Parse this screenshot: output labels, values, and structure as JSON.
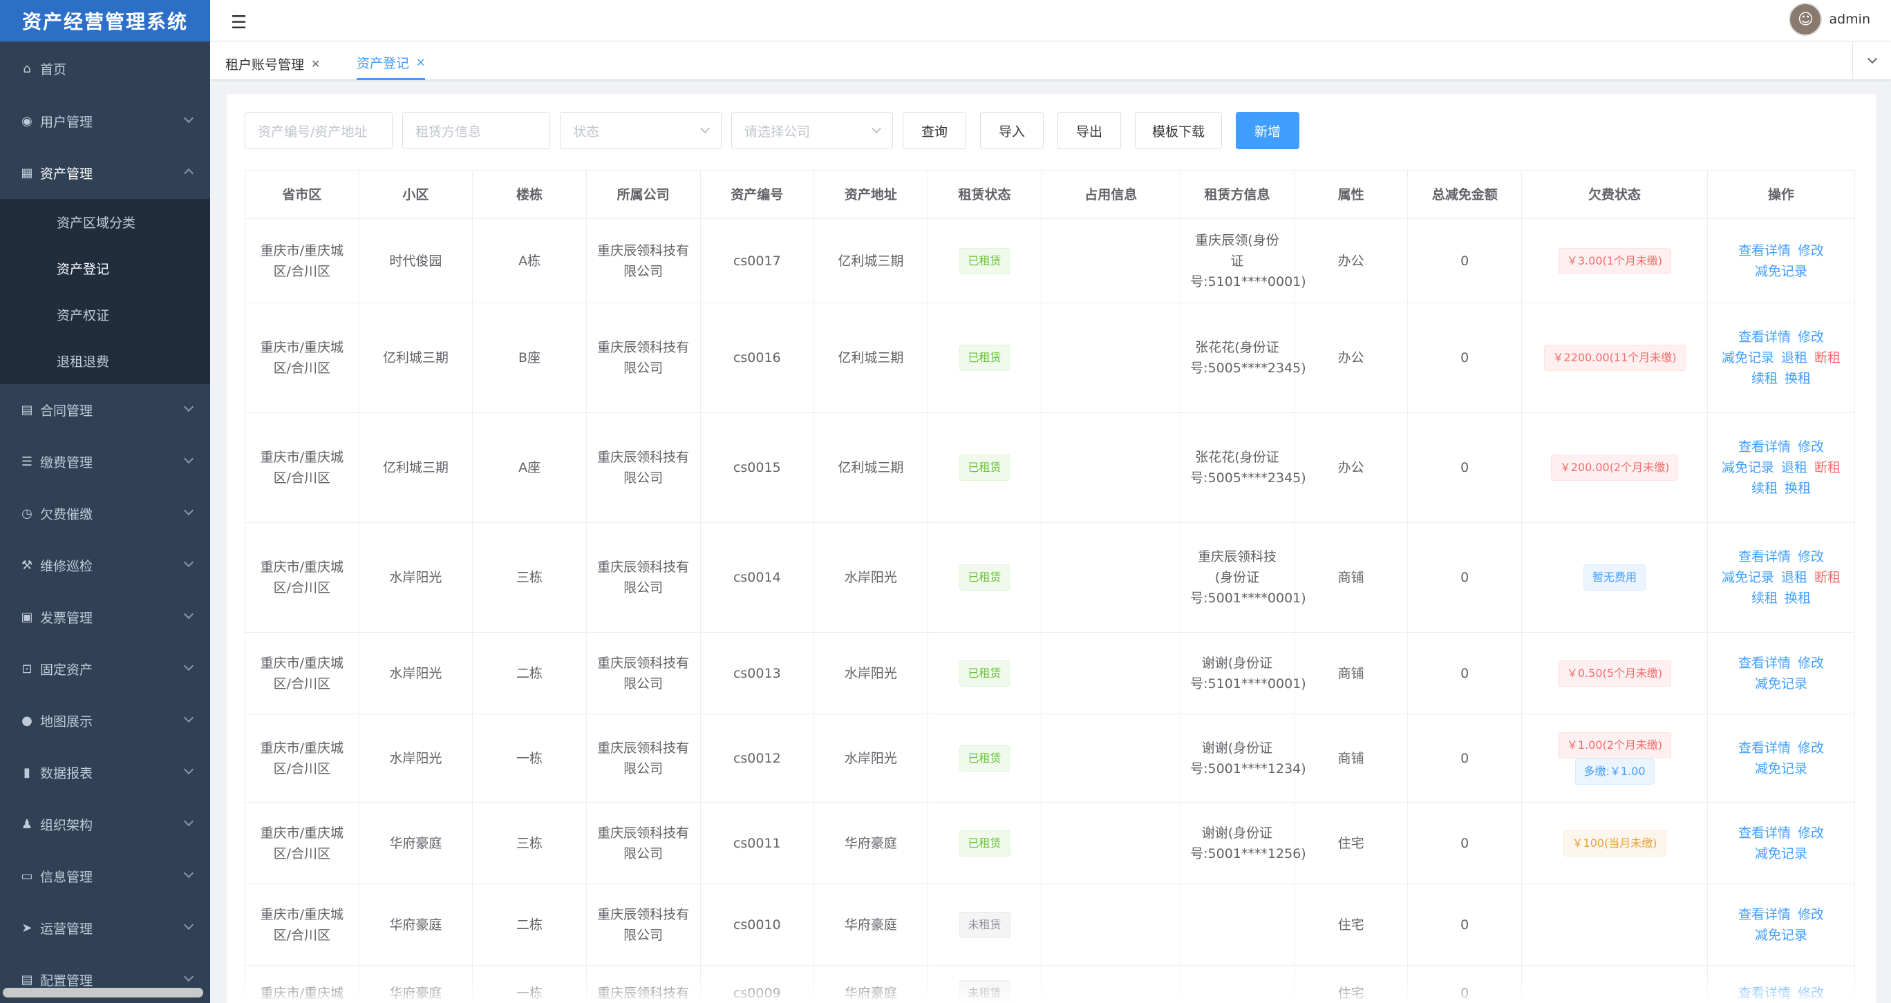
{
  "app": {
    "title": "资产经营管理系统"
  },
  "header": {
    "user_name": "admin"
  },
  "sidebar": {
    "items": [
      {
        "label": "首页",
        "icon": "home-icon",
        "glyph": "⌂"
      },
      {
        "label": "用户管理",
        "icon": "user-circle-icon",
        "glyph": "◉"
      },
      {
        "label": "资产管理",
        "icon": "grid-icon",
        "glyph": "▦",
        "expanded": true,
        "children": [
          {
            "label": "资产区域分类"
          },
          {
            "label": "资产登记",
            "active": true
          },
          {
            "label": "资产权证"
          },
          {
            "label": "退租退费"
          }
        ]
      },
      {
        "label": "合同管理",
        "icon": "document-icon",
        "glyph": "▤"
      },
      {
        "label": "缴费管理",
        "icon": "list-icon",
        "glyph": "☰"
      },
      {
        "label": "欠费催缴",
        "icon": "clock-icon",
        "glyph": "◷"
      },
      {
        "label": "维修巡检",
        "icon": "tool-icon",
        "glyph": "⚒"
      },
      {
        "label": "发票管理",
        "icon": "invoice-icon",
        "glyph": "▣"
      },
      {
        "label": "固定资产",
        "icon": "lock-icon",
        "glyph": "⊡"
      },
      {
        "label": "地图展示",
        "icon": "location-icon",
        "glyph": "●"
      },
      {
        "label": "数据报表",
        "icon": "bar-chart-icon",
        "glyph": "▮"
      },
      {
        "label": "组织架构",
        "icon": "person-icon",
        "glyph": "♟"
      },
      {
        "label": "信息管理",
        "icon": "message-icon",
        "glyph": "▭"
      },
      {
        "label": "运营管理",
        "icon": "send-icon",
        "glyph": "➤"
      },
      {
        "label": "配置管理",
        "icon": "settings-doc-icon",
        "glyph": "▤"
      }
    ]
  },
  "tabs": [
    {
      "label": "租户账号管理",
      "active": false
    },
    {
      "label": "资产登记",
      "active": true
    }
  ],
  "filters": {
    "asset_code_placeholder": "资产编号/资产地址",
    "tenant_placeholder": "租赁方信息",
    "status_placeholder": "状态",
    "company_placeholder": "请选择公司"
  },
  "buttons": {
    "query": "查询",
    "import": "导入",
    "export": "导出",
    "template": "模板下载",
    "add": "新增"
  },
  "table": {
    "columns": [
      "省市区",
      "小区",
      "楼栋",
      "所属公司",
      "资产编号",
      "资产地址",
      "租赁状态",
      "占用信息",
      "租赁方信息",
      "属性",
      "总减免金额",
      "欠费状态",
      "操作"
    ],
    "rows": [
      {
        "region": "重庆市/重庆城区/合川区",
        "community": "时代俊园",
        "building": "A栋",
        "company": "重庆辰领科技有限公司",
        "code": "cs0017",
        "address": "亿利城三期",
        "status": "已租赁",
        "status_type": "success",
        "occupancy": "",
        "tenant": "重庆辰领(身份证号:5101****0001)",
        "property": "办公",
        "discount": "0",
        "arrears": [
          {
            "text": "￥3.00(1个月未缴)",
            "type": "danger"
          }
        ],
        "ops": [
          [
            "查看详情",
            "修改"
          ],
          [
            "减免记录"
          ]
        ]
      },
      {
        "region": "重庆市/重庆城区/合川区",
        "community": "亿利城三期",
        "building": "B座",
        "company": "重庆辰领科技有限公司",
        "code": "cs0016",
        "address": "亿利城三期",
        "status": "已租赁",
        "status_type": "success",
        "occupancy": "",
        "tenant": "张花花(身份证号:5005****2345)",
        "property": "办公",
        "discount": "0",
        "arrears": [
          {
            "text": "￥2200.00(11个月未缴)",
            "type": "danger"
          }
        ],
        "ops": [
          [
            "查看详情",
            "修改"
          ],
          [
            "减免记录",
            "退租",
            "断租"
          ],
          [
            "续租",
            "换租"
          ]
        ]
      },
      {
        "region": "重庆市/重庆城区/合川区",
        "community": "亿利城三期",
        "building": "A座",
        "company": "重庆辰领科技有限公司",
        "code": "cs0015",
        "address": "亿利城三期",
        "status": "已租赁",
        "status_type": "success",
        "occupancy": "",
        "tenant": "张花花(身份证号:5005****2345)",
        "property": "办公",
        "discount": "0",
        "arrears": [
          {
            "text": "￥200.00(2个月未缴)",
            "type": "danger"
          }
        ],
        "ops": [
          [
            "查看详情",
            "修改"
          ],
          [
            "减免记录",
            "退租",
            "断租"
          ],
          [
            "续租",
            "换租"
          ]
        ]
      },
      {
        "region": "重庆市/重庆城区/合川区",
        "community": "水岸阳光",
        "building": "三栋",
        "company": "重庆辰领科技有限公司",
        "code": "cs0014",
        "address": "水岸阳光",
        "status": "已租赁",
        "status_type": "success",
        "occupancy": "",
        "tenant": "重庆辰领科技(身份证号:5001****0001)",
        "property": "商铺",
        "discount": "0",
        "arrears": [
          {
            "text": "暂无费用",
            "type": "primary"
          }
        ],
        "ops": [
          [
            "查看详情",
            "修改"
          ],
          [
            "减免记录",
            "退租",
            "断租"
          ],
          [
            "续租",
            "换租"
          ]
        ]
      },
      {
        "region": "重庆市/重庆城区/合川区",
        "community": "水岸阳光",
        "building": "二栋",
        "company": "重庆辰领科技有限公司",
        "code": "cs0013",
        "address": "水岸阳光",
        "status": "已租赁",
        "status_type": "success",
        "occupancy": "",
        "tenant": "谢谢(身份证号:5101****0001)",
        "property": "商铺",
        "discount": "0",
        "arrears": [
          {
            "text": "￥0.50(5个月未缴)",
            "type": "danger"
          }
        ],
        "ops": [
          [
            "查看详情",
            "修改"
          ],
          [
            "减免记录"
          ]
        ]
      },
      {
        "region": "重庆市/重庆城区/合川区",
        "community": "水岸阳光",
        "building": "一栋",
        "company": "重庆辰领科技有限公司",
        "code": "cs0012",
        "address": "水岸阳光",
        "status": "已租赁",
        "status_type": "success",
        "occupancy": "",
        "tenant": "谢谢(身份证号:5001****1234)",
        "property": "商铺",
        "discount": "0",
        "arrears": [
          {
            "text": "￥1.00(2个月未缴)",
            "type": "danger"
          },
          {
            "text": "多缴:￥1.00",
            "type": "primary"
          }
        ],
        "ops": [
          [
            "查看详情",
            "修改"
          ],
          [
            "减免记录"
          ]
        ]
      },
      {
        "region": "重庆市/重庆城区/合川区",
        "community": "华府豪庭",
        "building": "三栋",
        "company": "重庆辰领科技有限公司",
        "code": "cs0011",
        "address": "华府豪庭",
        "status": "已租赁",
        "status_type": "success",
        "occupancy": "",
        "tenant": "谢谢(身份证号:5001****1256)",
        "property": "住宅",
        "discount": "0",
        "arrears": [
          {
            "text": "￥100(当月未缴)",
            "type": "warning"
          }
        ],
        "ops": [
          [
            "查看详情",
            "修改"
          ],
          [
            "减免记录"
          ]
        ]
      },
      {
        "region": "重庆市/重庆城区/合川区",
        "community": "华府豪庭",
        "building": "二栋",
        "company": "重庆辰领科技有限公司",
        "code": "cs0010",
        "address": "华府豪庭",
        "status": "未租赁",
        "status_type": "info",
        "occupancy": "",
        "tenant": "",
        "property": "住宅",
        "discount": "0",
        "arrears": [],
        "ops": [
          [
            "查看详情",
            "修改"
          ],
          [
            "减免记录"
          ]
        ]
      },
      {
        "region": "重庆市/重庆城",
        "community": "华府豪庭",
        "building": "一栋",
        "company": "重庆辰领科技有",
        "code": "cs0009",
        "address": "华府豪庭",
        "status": "未租赁",
        "status_type": "info",
        "occupancy": "",
        "tenant": "",
        "property": "住宅",
        "discount": "0",
        "arrears": [],
        "ops": [
          [
            "查看详情",
            "修改"
          ]
        ]
      }
    ]
  },
  "colors": {
    "primary": "#409eff",
    "sidebar_bg": "#304156",
    "logo_bg": "#2b6fc7",
    "danger": "#f56c6c",
    "success": "#67c23a"
  }
}
